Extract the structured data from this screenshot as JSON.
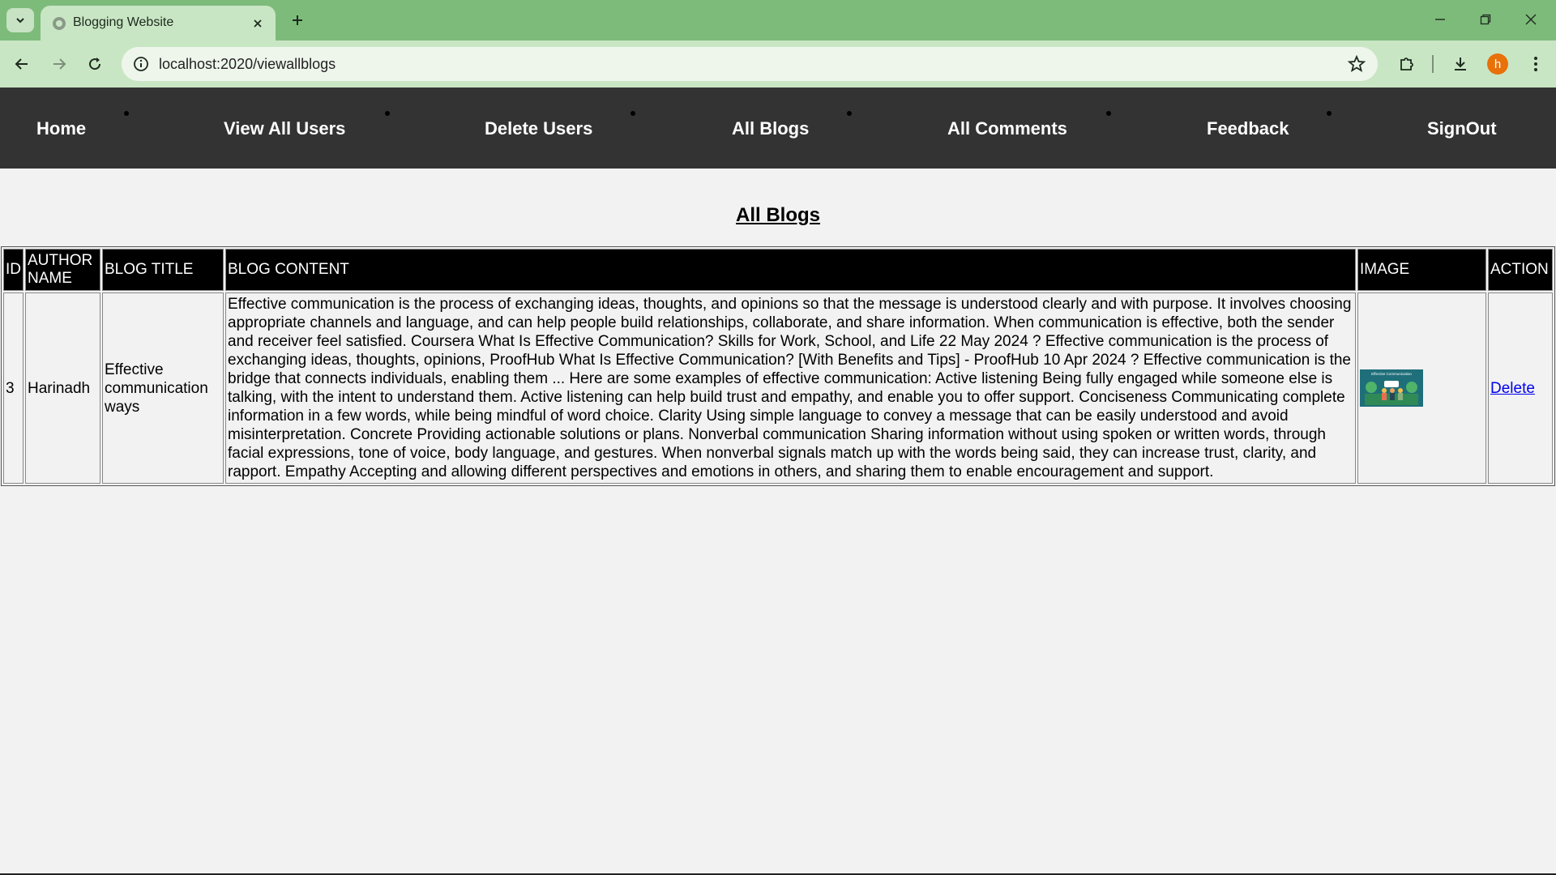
{
  "browser": {
    "tab_title": "Blogging Website",
    "url": "localhost:2020/viewallblogs",
    "profile_initial": "h"
  },
  "nav": {
    "items": [
      "Home",
      "View All Users",
      "Delete Users",
      "All Blogs",
      "All Comments",
      "Feedback",
      "SignOut"
    ]
  },
  "page": {
    "heading": "All Blogs"
  },
  "table": {
    "headers": {
      "id": "ID",
      "author": "AUTHOR NAME",
      "title": "BLOG TITLE",
      "content": "BLOG CONTENT",
      "image": "IMAGE",
      "action": "ACTION"
    },
    "rows": [
      {
        "id": "3",
        "author": "Harinadh",
        "title": "Effective communication ways",
        "content": "Effective communication is the process of exchanging ideas, thoughts, and opinions so that the message is understood clearly and with purpose. It involves choosing appropriate channels and language, and can help people build relationships, collaborate, and share information. When communication is effective, both the sender and receiver feel satisfied. Coursera What Is Effective Communication? Skills for Work, School, and Life 22 May 2024 ? Effective communication is the process of exchanging ideas, thoughts, opinions, ProofHub What Is Effective Communication? [With Benefits and Tips] - ProofHub 10 Apr 2024 ? Effective communication is the bridge that connects individuals, enabling them ... Here are some examples of effective communication: Active listening Being fully engaged while someone else is talking, with the intent to understand them. Active listening can help build trust and empathy, and enable you to offer support. Conciseness Communicating complete information in a few words, while being mindful of word choice. Clarity Using simple language to convey a message that can be easily understood and avoid misinterpretation. Concrete Providing actionable solutions or plans. Nonverbal communication Sharing information without using spoken or written words, through facial expressions, tone of voice, body language, and gestures. When nonverbal signals match up with the words being said, they can increase trust, clarity, and rapport. Empathy Accepting and allowing different perspectives and emotions in others, and sharing them to enable encouragement and support.",
        "image_caption": "Effective Communication",
        "action": "Delete"
      }
    ]
  },
  "colors": {
    "tabstrip": "#7dbb7b",
    "toolbar": "#c9e6c4",
    "nav_bg": "#333333",
    "table_header_bg": "#000000",
    "link": "#0000ee",
    "avatar": "#e8710a"
  }
}
